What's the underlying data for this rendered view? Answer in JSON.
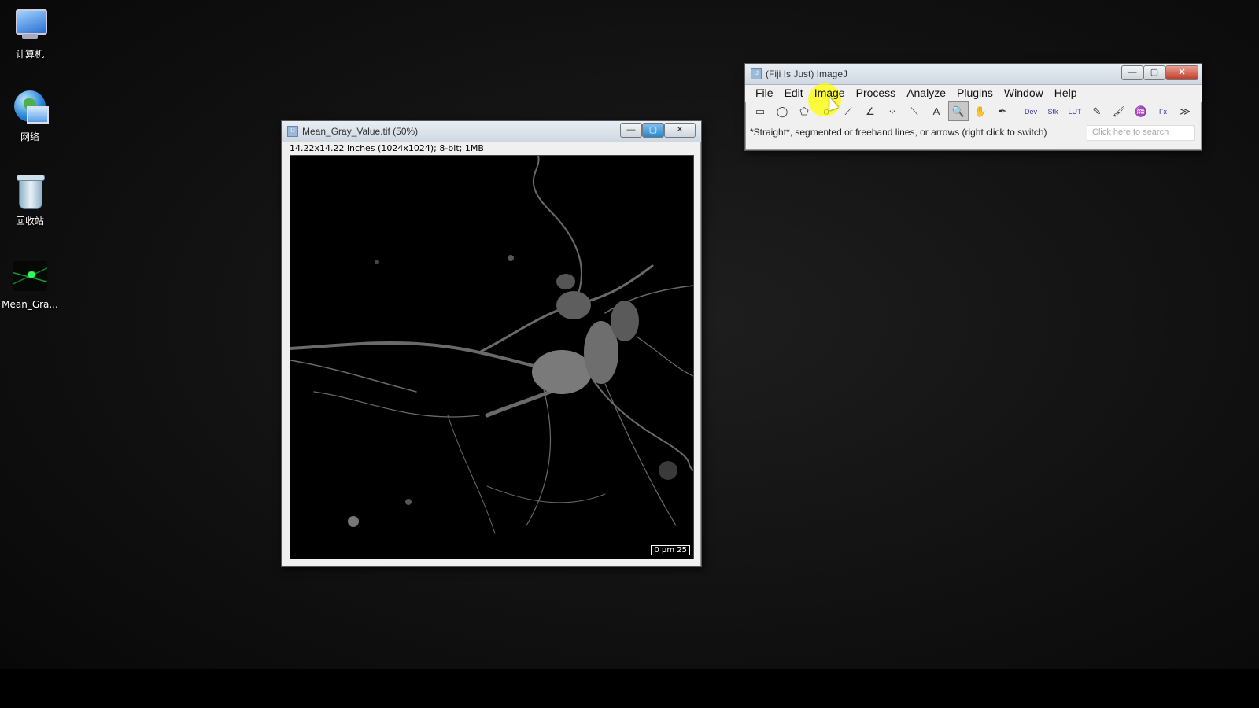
{
  "desktop": {
    "icons": [
      {
        "label": "计算机",
        "icon": "computer-icon"
      },
      {
        "label": "网络",
        "icon": "network-icon"
      },
      {
        "label": "回收站",
        "icon": "recycle-bin-icon"
      },
      {
        "label": "Mean_Gra...",
        "icon": "image-file-icon"
      }
    ]
  },
  "image_window": {
    "title": "Mean_Gray_Value.tif (50%)",
    "info": "14.22x14.22 inches (1024x1024); 8-bit; 1MB",
    "scale_bar": "0  µm 25"
  },
  "fiji": {
    "title": "(Fiji Is Just) ImageJ",
    "menus": [
      "File",
      "Edit",
      "Image",
      "Process",
      "Analyze",
      "Plugins",
      "Window",
      "Help"
    ],
    "highlighted_menu": "Image",
    "status": "*Straight*, segmented or freehand lines, or arrows (right click to switch)",
    "search_placeholder": "Click here to search",
    "tools": [
      {
        "name": "rectangle-tool-icon",
        "glyph": "▭"
      },
      {
        "name": "oval-tool-icon",
        "glyph": "◯"
      },
      {
        "name": "polygon-tool-icon",
        "glyph": "⬠"
      },
      {
        "name": "freehand-tool-icon",
        "glyph": "◌"
      },
      {
        "name": "line-tool-icon",
        "glyph": "⟋"
      },
      {
        "name": "angle-tool-icon",
        "glyph": "∠"
      },
      {
        "name": "multipoint-tool-icon",
        "glyph": "⁘"
      },
      {
        "name": "wand-tool-icon",
        "glyph": "⟍"
      },
      {
        "name": "text-tool-icon",
        "glyph": "A"
      },
      {
        "name": "magnifier-tool-icon",
        "glyph": "🔍"
      },
      {
        "name": "hand-tool-icon",
        "glyph": "✋"
      },
      {
        "name": "dropper-tool-icon",
        "glyph": "✒"
      },
      {
        "name": "dev-tool-icon",
        "glyph": "Dev"
      },
      {
        "name": "stk-tool-icon",
        "glyph": "Stk"
      },
      {
        "name": "lut-tool-icon",
        "glyph": "LUT"
      },
      {
        "name": "pencil-tool-icon",
        "glyph": "✎"
      },
      {
        "name": "brush-tool-icon",
        "glyph": "🖌"
      },
      {
        "name": "flood-fill-tool-icon",
        "glyph": "♒"
      },
      {
        "name": "fx-tool-icon",
        "glyph": "Fx"
      },
      {
        "name": "more-tools-icon",
        "glyph": "≫"
      }
    ],
    "selected_tool_index": 9
  },
  "colors": {
    "highlight": "#ffff00",
    "close_button": "#c0392b"
  }
}
